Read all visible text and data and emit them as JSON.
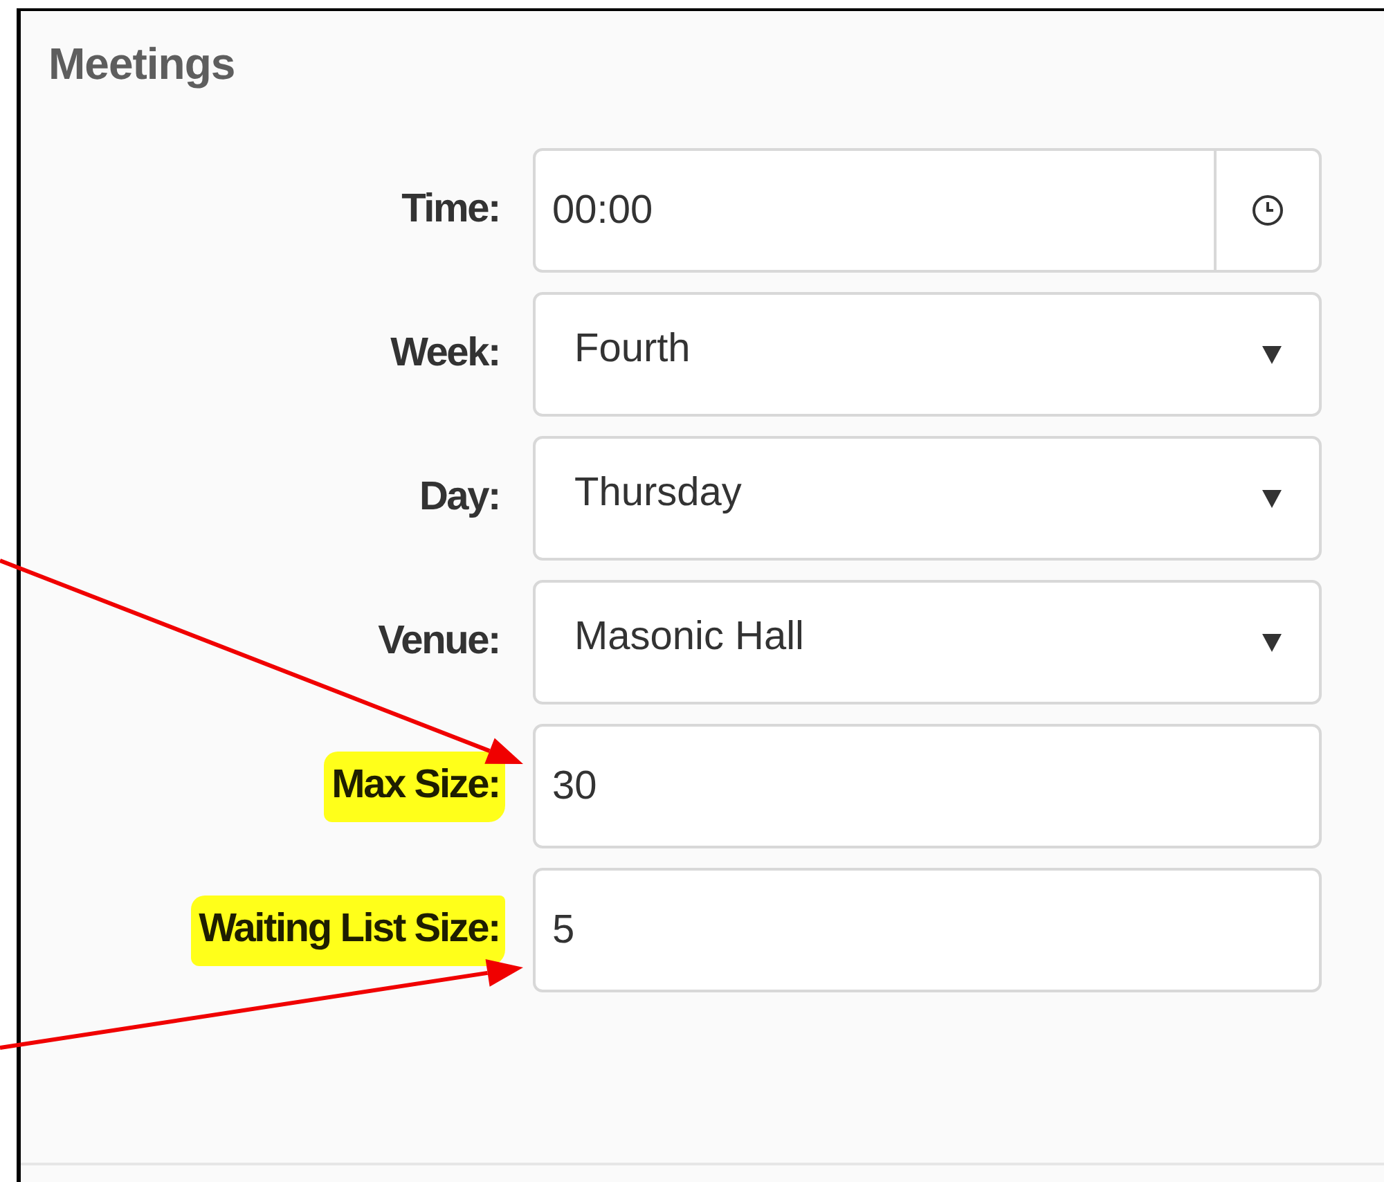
{
  "title": "Meetings",
  "fields": [
    {
      "kind": "time",
      "label": "Time:",
      "value": "00:00",
      "highlighted": false,
      "arrow": false
    },
    {
      "kind": "select",
      "label": "Week:",
      "value": "Fourth",
      "highlighted": false,
      "arrow": false
    },
    {
      "kind": "select",
      "label": "Day:",
      "value": "Thursday",
      "highlighted": false,
      "arrow": false
    },
    {
      "kind": "select",
      "label": "Venue:",
      "value": "Masonic Hall",
      "highlighted": false,
      "arrow": false
    },
    {
      "kind": "text",
      "label": "Max Size:",
      "value": "30",
      "highlighted": true,
      "arrow": true
    },
    {
      "kind": "text",
      "label": "Waiting List Size:",
      "value": "5",
      "highlighted": true,
      "arrow": true
    }
  ]
}
